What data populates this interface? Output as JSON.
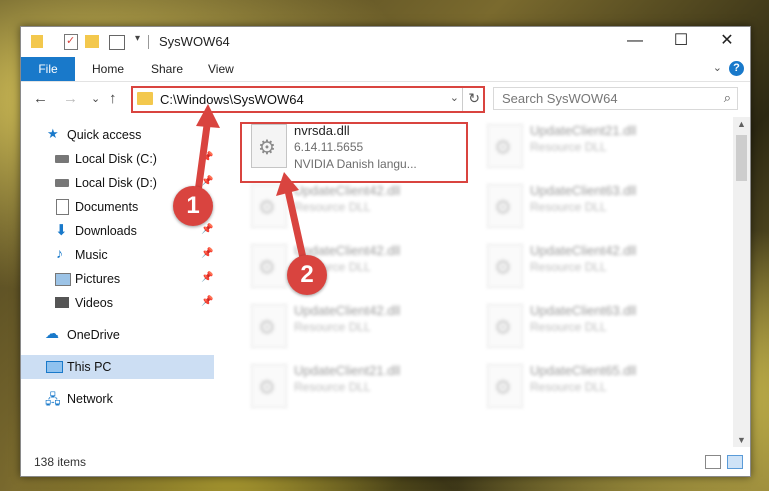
{
  "window": {
    "title": "SysWOW64",
    "icons": [
      "folder-icon",
      "properties-icon",
      "new-folder-icon",
      "view-icon"
    ],
    "controls": {
      "minimize": "—",
      "maximize": "☐",
      "close": "✕"
    }
  },
  "ribbon": {
    "tabs": [
      "File",
      "Home",
      "Share",
      "View"
    ],
    "help": "?"
  },
  "navigation": {
    "back": "←",
    "forward": "→",
    "recent": "⌄",
    "up": "↑",
    "address": "C:\\Windows\\SysWOW64",
    "search_placeholder": "Search SysWOW64"
  },
  "sidebar": {
    "items": [
      {
        "label": "Quick access",
        "icon": "star-icon",
        "pinned": false
      },
      {
        "label": "Local Disk (C:)",
        "icon": "drive-icon",
        "pinned": true
      },
      {
        "label": "Local Disk (D:)",
        "icon": "drive-icon",
        "pinned": true
      },
      {
        "label": "Documents",
        "icon": "documents-icon",
        "pinned": true
      },
      {
        "label": "Downloads",
        "icon": "downloads-icon",
        "pinned": true
      },
      {
        "label": "Music",
        "icon": "music-icon",
        "pinned": true
      },
      {
        "label": "Pictures",
        "icon": "pictures-icon",
        "pinned": true
      },
      {
        "label": "Videos",
        "icon": "videos-icon",
        "pinned": true
      },
      {
        "label": "OneDrive",
        "icon": "cloud-icon",
        "pinned": false
      },
      {
        "label": "This PC",
        "icon": "computer-icon",
        "pinned": false,
        "selected": true
      },
      {
        "label": "Network",
        "icon": "network-icon",
        "pinned": false
      }
    ]
  },
  "files": [
    {
      "name": "nvrsda.dll",
      "version": "6.14.11.5655",
      "description": "NVIDIA Danish langu...",
      "focus": true
    },
    {
      "name": "UpdateClient21.dll",
      "version": "Resource DLL",
      "description": ""
    },
    {
      "name": "UpdateClient42.dll",
      "version": "Resource DLL",
      "description": ""
    },
    {
      "name": "UpdateClient63.dll",
      "version": "Resource DLL",
      "description": ""
    },
    {
      "name": "UpdateClient42.dll",
      "version": "Resource DLL",
      "description": ""
    },
    {
      "name": "UpdateClient42.dll",
      "version": "Resource DLL",
      "description": ""
    },
    {
      "name": "UpdateClient42.dll",
      "version": "Resource DLL",
      "description": ""
    },
    {
      "name": "UpdateClient63.dll",
      "version": "Resource DLL",
      "description": ""
    },
    {
      "name": "UpdateClient21.dll",
      "version": "Resource DLL",
      "description": ""
    },
    {
      "name": "UpdateClient65.dll",
      "version": "Resource DLL",
      "description": ""
    }
  ],
  "annotations": {
    "marker1": "1",
    "marker2": "2",
    "color": "#d9443f"
  },
  "status": {
    "items": "138 items"
  }
}
